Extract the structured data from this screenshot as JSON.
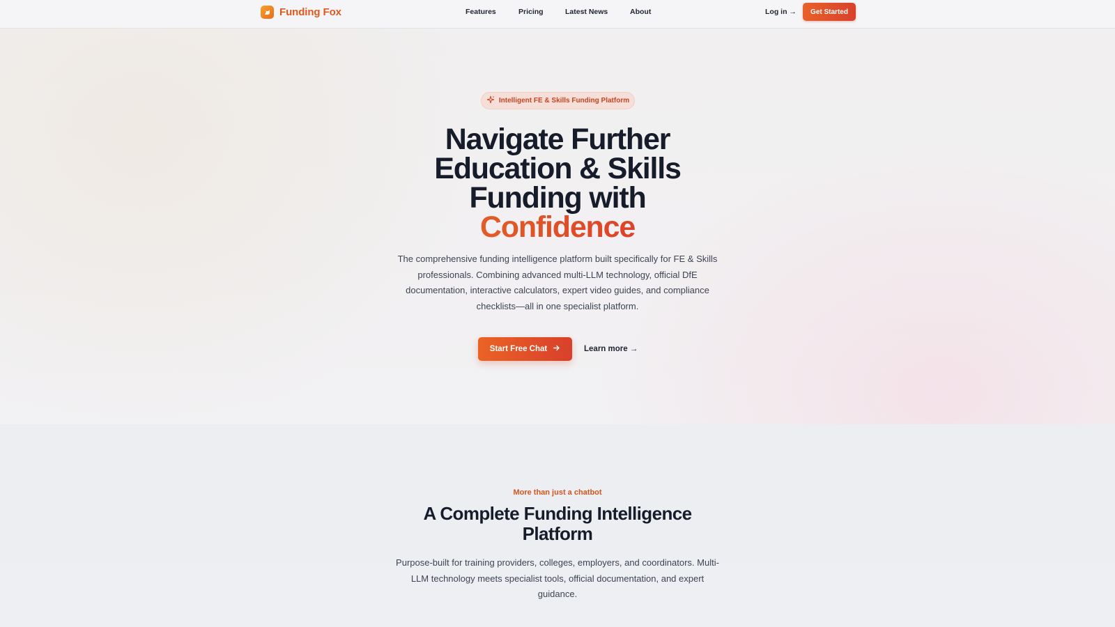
{
  "nav": {
    "brand": "Funding Fox",
    "links": [
      "Features",
      "Pricing",
      "Latest News",
      "About"
    ],
    "login": "Log in →",
    "cta": "Get Started"
  },
  "hero": {
    "badge": "Intelligent FE & Skills Funding Platform",
    "headline_main": "Navigate Further Education & Skills Funding with",
    "headline_accent": "Confidence",
    "subtitle": "The comprehensive funding intelligence platform built specifically for FE & Skills professionals. Combining advanced multi-LLM technology, official DfE documentation, interactive calculators, expert video guides, and compliance checklists—all in one specialist platform.",
    "primary_cta": "Start Free Chat",
    "secondary_cta": "Learn more →"
  },
  "section": {
    "eyebrow": "More than just a chatbot",
    "title": "A Complete Funding Intelligence Platform",
    "subtitle": "Purpose-built for training providers, colleges, employers, and coordinators. Multi-LLM technology meets specialist tools, official documentation, and expert guidance."
  },
  "colors": {
    "accent": "#e0581d",
    "accent_red": "#d9412a",
    "text_dark": "#171c2b"
  }
}
